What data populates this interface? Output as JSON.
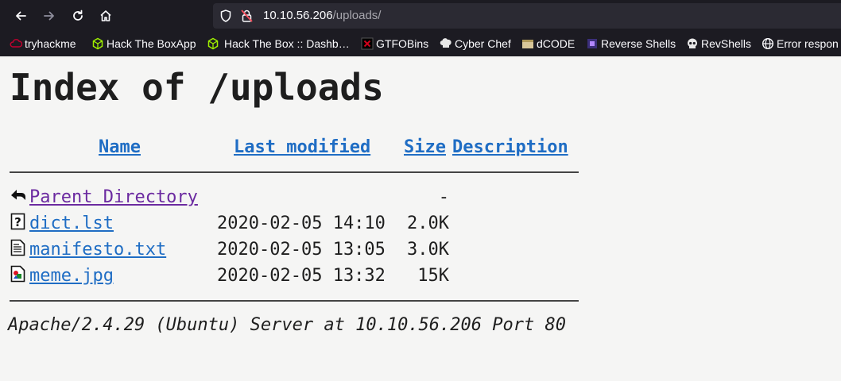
{
  "browser": {
    "url_host": "10.10.56.206",
    "url_path": "/uploads/",
    "bookmarks": [
      {
        "label": "tryhackme",
        "icon": "tryhackme-icon"
      },
      {
        "label": "Hack The BoxApp",
        "icon": "htb-cube-icon"
      },
      {
        "label": "Hack The Box :: Dashb…",
        "icon": "htb-cube-icon"
      },
      {
        "label": "GTFOBins",
        "icon": "gtfobins-icon"
      },
      {
        "label": "Cyber Chef",
        "icon": "chef-hat-icon"
      },
      {
        "label": "dCODE",
        "icon": "dcode-icon"
      },
      {
        "label": "Reverse Shells",
        "icon": "reverse-shells-icon"
      },
      {
        "label": "RevShells",
        "icon": "skull-icon"
      },
      {
        "label": "Error respon",
        "icon": "globe-icon"
      }
    ]
  },
  "page": {
    "title": "Index of /uploads",
    "headers": {
      "name": "Name",
      "last_modified": "Last modified",
      "size": "Size",
      "description": "Description"
    },
    "rows": [
      {
        "name": "Parent Directory",
        "date": "",
        "size": "-",
        "icon": "back-arrow-icon",
        "visited": true
      },
      {
        "name": "dict.lst",
        "date": "2020-02-05 14:10",
        "size": "2.0K",
        "icon": "unknown-file-icon",
        "visited": false
      },
      {
        "name": "manifesto.txt",
        "date": "2020-02-05 13:05",
        "size": "3.0K",
        "icon": "text-file-icon",
        "visited": false
      },
      {
        "name": "meme.jpg",
        "date": "2020-02-05 13:32",
        "size": "15K",
        "icon": "image-file-icon",
        "visited": false
      }
    ],
    "footer": "Apache/2.4.29 (Ubuntu) Server at 10.10.56.206 Port 80"
  },
  "colors": {
    "link": "#1f6dc4",
    "visited_link": "#6b2aa0",
    "chrome_bg": "#1c1b22",
    "urlbar_bg": "#2b2a33",
    "page_bg": "#f5f5f4"
  }
}
